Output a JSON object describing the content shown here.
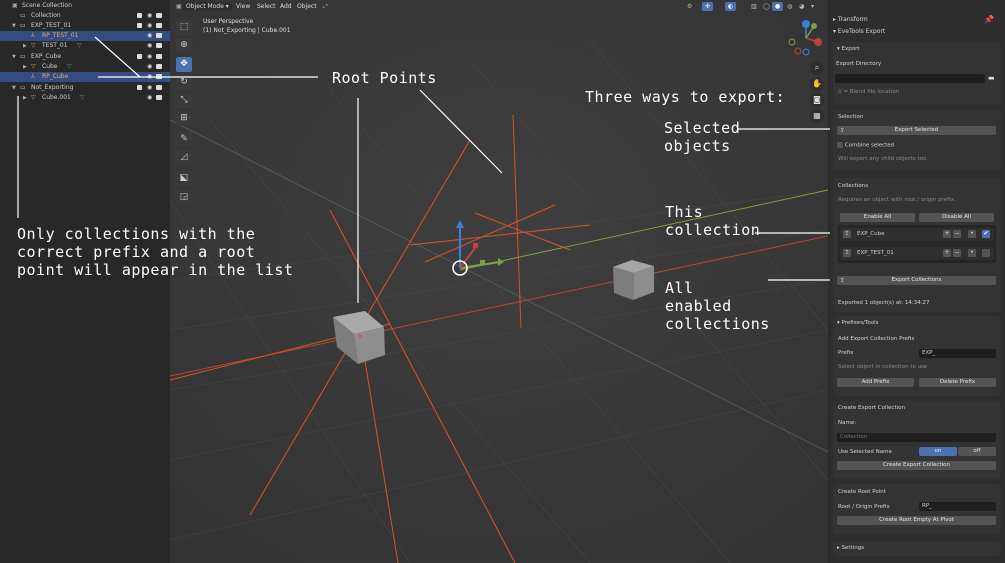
{
  "outliner": {
    "rows": [
      {
        "label": "Scene Collection"
      },
      {
        "label": "Collection"
      },
      {
        "label": "EXP_TEST_01"
      },
      {
        "label": "RP_TEST_01"
      },
      {
        "label": "TEST_01"
      },
      {
        "label": "EXP_Cube"
      },
      {
        "label": "Cube"
      },
      {
        "label": "RP_Cube"
      },
      {
        "label": "Not_Exporting"
      },
      {
        "label": "Cube.001"
      }
    ]
  },
  "viewport": {
    "header": {
      "mode": "Object Mode",
      "menus": [
        "View",
        "Select",
        "Add",
        "Object"
      ]
    },
    "perspective": "User Perspective",
    "context": "(1) Not_Exporting | Cube.001"
  },
  "annotations": {
    "root_points": "Root Points",
    "three_ways": "Three ways to export:",
    "selected_objects": "Selected\nobjects",
    "this_collection": "This\ncollection",
    "all_enabled": "All\nenabled\ncollections",
    "only_collections": "Only collections with the\ncorrect prefix and a root\npoint will appear in the list"
  },
  "properties": {
    "transform": "Transform",
    "addon": "EveTools Export",
    "export": {
      "header": "Export",
      "dir_label": "Export Directory",
      "dir_value": "",
      "dir_hint": "// = Blend file location"
    },
    "selection": {
      "header": "Selection",
      "export_selected": "Export Selected",
      "combine": "Combine selected",
      "hint": "Will export any child objects too."
    },
    "collections": {
      "header": "Collections",
      "hint": "Requires an object with root / origin prefix.",
      "enable_all": "Enable All",
      "disable_all": "Disable All",
      "items": [
        {
          "name": "EXP_Cube",
          "enabled": true
        },
        {
          "name": "EXP_TEST_01",
          "enabled": false
        }
      ],
      "export_collections": "Export Collections",
      "status": "Exported 1 object(s) at: 14:34:27"
    },
    "prefixes": {
      "header": "Prefixes/Tools",
      "add_label": "Add Export Collection Prefix",
      "prefix_label": "Prefix",
      "prefix_value": "EXP_",
      "hint": "Select object in collection to use",
      "add_prefix": "Add Prefix",
      "delete_prefix": "Delete Prefix"
    },
    "create_collection": {
      "header": "Create Export Collection",
      "name_label": "Name:",
      "name_placeholder": "Collection",
      "use_selected_label": "Use Selected Name",
      "on": "on",
      "off": "off",
      "button": "Create Export Collection"
    },
    "root_point": {
      "header": "Create Root Point",
      "prefix_label": "Root / Origin Prefix",
      "prefix_value": "RP_",
      "button": "Create Root Empty At Pivot"
    },
    "settings": "Settings"
  },
  "colors": {
    "accent": "#4a72b3",
    "selected_row": "#334d80",
    "x_axis": "#b9453a",
    "y_axis": "#7aa142",
    "root_line": "#d8532a"
  }
}
